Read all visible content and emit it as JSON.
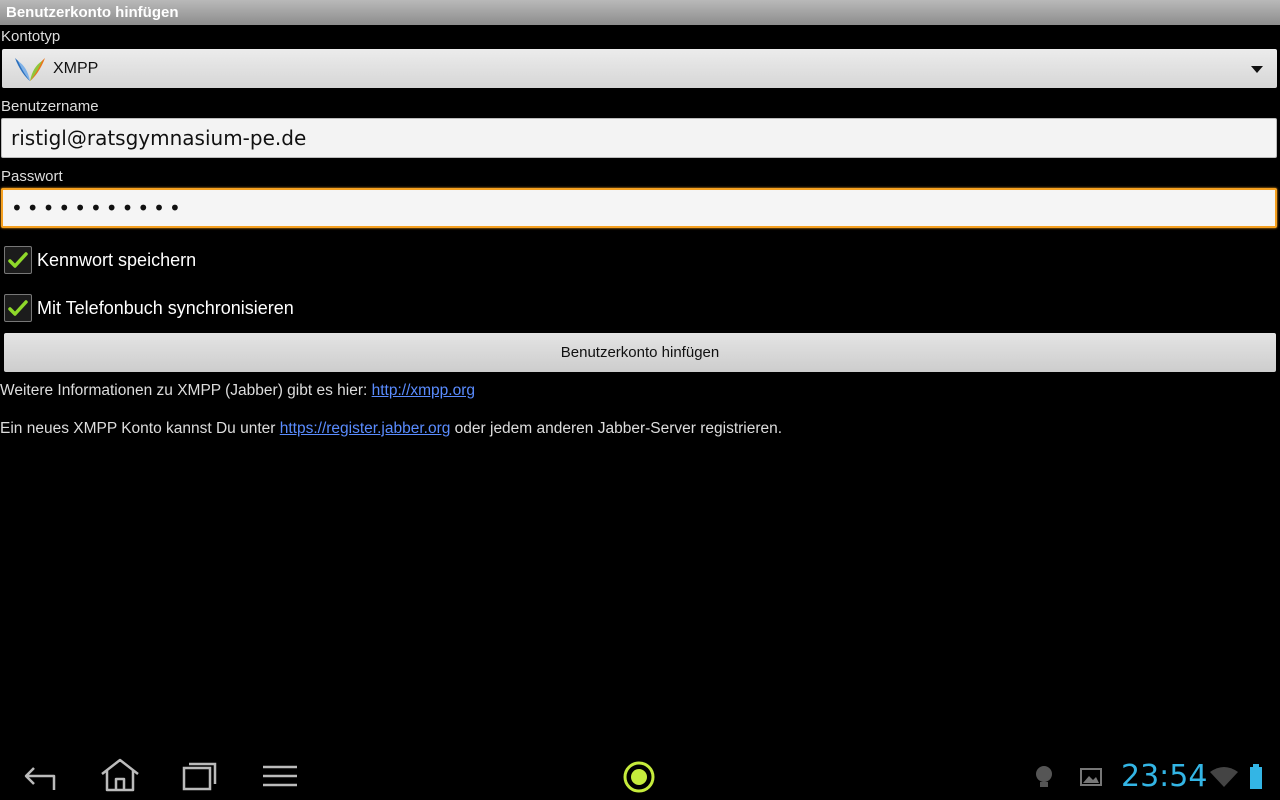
{
  "window": {
    "title": "Benutzerkonto hinfügen"
  },
  "form": {
    "account_type_label": "Kontotyp",
    "account_type_value": "XMPP",
    "account_type_logo": "xmpp-logo",
    "username_label": "Benutzername",
    "username_value": "ristigl@ratsgymnasium-pe.de",
    "password_label": "Passwort",
    "password_value": "•••••••••••",
    "save_password_label": "Kennwort speichern",
    "save_password_checked": true,
    "sync_phonebook_label": "Mit Telefonbuch synchronisieren",
    "sync_phonebook_checked": true,
    "submit_label": "Benutzerkonto hinfügen"
  },
  "info": {
    "line1_text": "Weitere Informationen zu XMPP (Jabber) gibt es hier: ",
    "line1_link": "http://xmpp.org",
    "line2_text_before": "Ein neues XMPP Konto kannst Du unter ",
    "line2_link": "https://register.jabber.org",
    "line2_text_after": " oder jedem anderen Jabber-Server registrieren."
  },
  "statusbar": {
    "time": "23:54",
    "icons": [
      "back-icon",
      "home-icon",
      "recent-apps-icon",
      "menu-icon",
      "app-notification-icon",
      "lightbulb-icon",
      "image-icon",
      "wifi-icon",
      "battery-icon"
    ],
    "accent_color": "#33b5e5",
    "notification_color": "#c6ec3c"
  },
  "colors": {
    "focus_border": "#f5a020",
    "link": "#5a8cff",
    "check": "#8fd92a"
  }
}
